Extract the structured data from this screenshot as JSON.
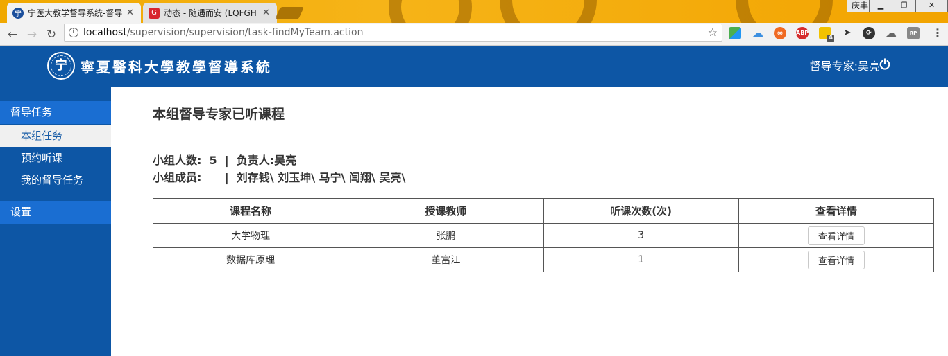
{
  "browser": {
    "tabs": [
      {
        "title": "宁医大教学督导系统-督导",
        "favicon": "ningxia-logo-icon"
      },
      {
        "title": "动态 - 随遇而安 (LQFGH",
        "favicon": "gitee-icon"
      }
    ],
    "profile_name": "庆丰",
    "url_host": "localhost",
    "url_path": "/supervision/supervision/task-findMyTeam.action",
    "extension_badge": "4",
    "extension_abp": "ABP"
  },
  "header": {
    "system_name": "寧夏醫科大學教學督導系統",
    "user_label": "督导专家:吴亮",
    "brand_color": "#0d56a5"
  },
  "sidebar": {
    "section1": "督导任务",
    "items": [
      {
        "label": "本组任务"
      },
      {
        "label": "预约听课"
      },
      {
        "label": "我的督导任务"
      }
    ],
    "section2": "设置"
  },
  "main": {
    "title": "本组督导专家已听课程",
    "team_line": "小组人数:  5  |  负责人:吴亮",
    "members_line": "小组成员:      |  刘存钱\\ 刘玉坤\\ 马宁\\ 闫翔\\ 吴亮\\",
    "table": {
      "headers": [
        "课程名称",
        "授课教师",
        "听课次数(次)",
        "查看详情"
      ],
      "rows": [
        {
          "course": "大学物理",
          "teacher": "张鹏",
          "count": "3",
          "action": "查看详情"
        },
        {
          "course": "数据库原理",
          "teacher": "董富江",
          "count": "1",
          "action": "查看详情"
        }
      ]
    }
  }
}
